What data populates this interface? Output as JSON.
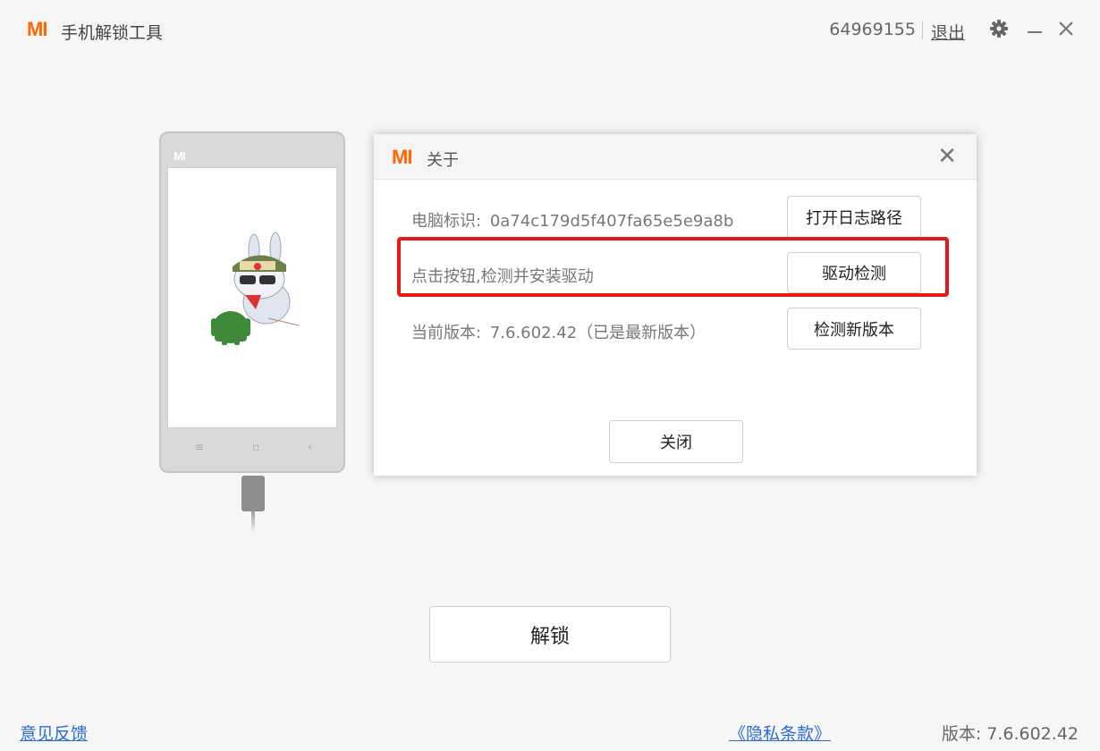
{
  "app": {
    "logo_text": "MI",
    "title": "手机解锁工具",
    "user_id": "64969155",
    "logout_label": "退出"
  },
  "phone": {
    "top_logo": "MI",
    "nav": [
      "≡",
      "▫",
      "‹"
    ]
  },
  "dialog": {
    "logo_text": "MI",
    "title": "关于",
    "close_glyph": "✕",
    "pc_id_label": "电脑标识:",
    "pc_id_value": "0a74c179d5f407fa65e5e9a8b",
    "open_log_button": "打开日志路径",
    "driver_hint": "点击按钮,检测并安装驱动",
    "driver_check_button": "驱动检测",
    "version_label": "当前版本:",
    "version_value": "7.6.602.42（已是最新版本）",
    "check_update_button": "检测新版本",
    "close_button": "关闭"
  },
  "main": {
    "unlock_button": "解锁"
  },
  "footer": {
    "feedback": "意见反馈",
    "privacy": "《隐私条款》",
    "version": "版本: 7.6.602.42"
  },
  "colors": {
    "brand": "#ff6700",
    "highlight": "#e61919",
    "link": "#2a6bd4"
  }
}
